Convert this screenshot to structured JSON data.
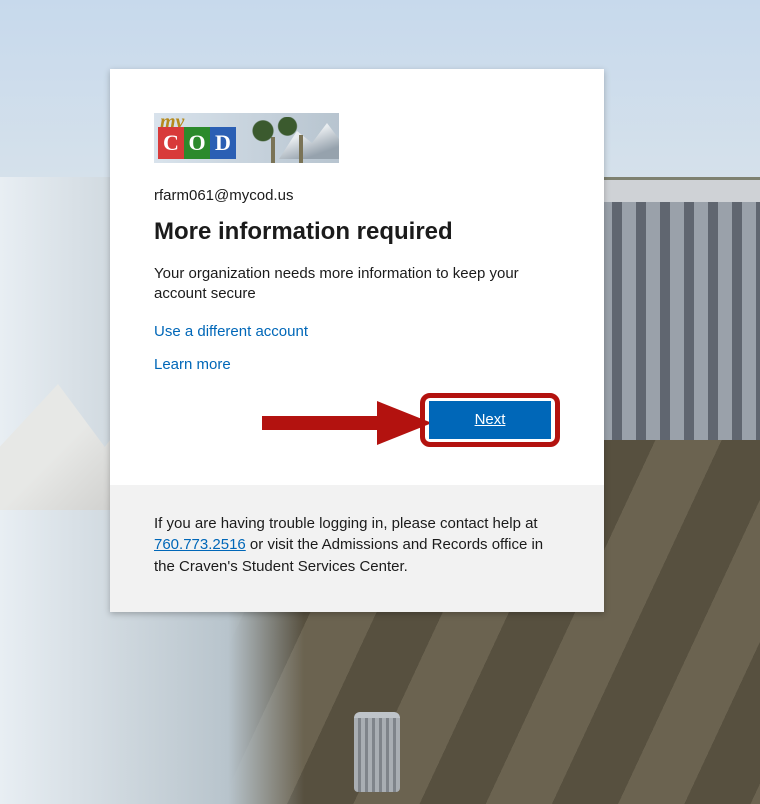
{
  "logo": {
    "prefix": "my",
    "letters": [
      "C",
      "O",
      "D"
    ],
    "semantic": "mycod-logo"
  },
  "email": "rfarm061@mycod.us",
  "title": "More information required",
  "description": "Your organization needs more information to keep your account secure",
  "links": {
    "use_different_account": "Use a different account",
    "learn_more": "Learn more"
  },
  "buttons": {
    "next": "Next"
  },
  "footer": {
    "pre": "If you are having trouble logging in, please contact help at ",
    "phone": "760.773.2516",
    "post": " or visit the Admissions and Records office in the Craven's Student Services Center."
  },
  "annotation": {
    "arrow_color": "#b3120f"
  }
}
